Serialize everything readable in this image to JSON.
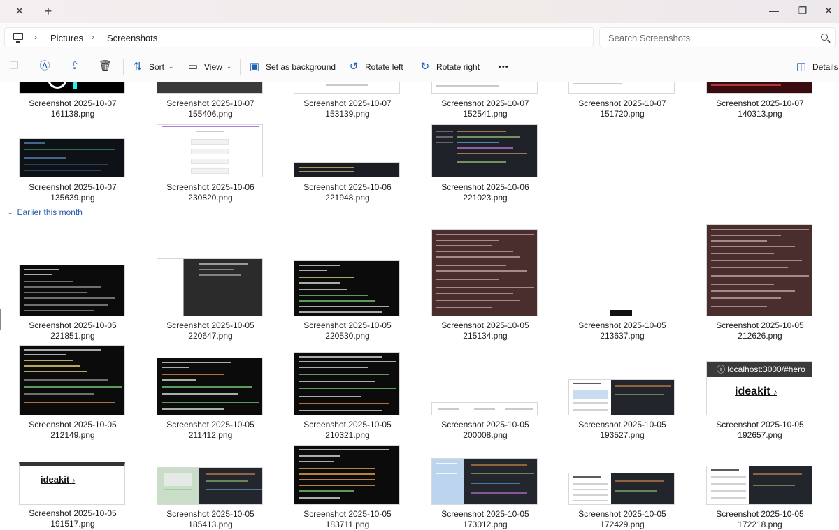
{
  "window": {
    "close_tab": "✕",
    "new_tab": "+",
    "minimize": "—",
    "maximize": "❐",
    "close": "✕"
  },
  "breadcrumb": [
    "Pictures",
    "Screenshots"
  ],
  "search": {
    "placeholder": "Search Screenshots"
  },
  "toolbar": {
    "sort": "Sort",
    "view": "View",
    "set_background": "Set as background",
    "rotate_left": "Rotate left",
    "rotate_right": "Rotate right",
    "more": "•••",
    "details": "Details"
  },
  "group": {
    "label": "Earlier this month"
  },
  "files": [
    {
      "line1": "Screenshot 2025-10-07",
      "line2": "161138.png"
    },
    {
      "line1": "Screenshot 2025-10-07",
      "line2": "155406.png"
    },
    {
      "line1": "Screenshot 2025-10-07",
      "line2": "153139.png"
    },
    {
      "line1": "Screenshot 2025-10-07",
      "line2": "152541.png"
    },
    {
      "line1": "Screenshot 2025-10-07",
      "line2": "151720.png"
    },
    {
      "line1": "Screenshot 2025-10-07",
      "line2": "140313.png"
    },
    {
      "line1": "Screenshot 2025-10-07",
      "line2": "135639.png"
    },
    {
      "line1": "Screenshot 2025-10-06",
      "line2": "230820.png"
    },
    {
      "line1": "Screenshot 2025-10-06",
      "line2": "221948.png"
    },
    {
      "line1": "Screenshot 2025-10-06",
      "line2": "221023.png"
    },
    {
      "line1": "Screenshot 2025-10-05",
      "line2": "221851.png"
    },
    {
      "line1": "Screenshot 2025-10-05",
      "line2": "220647.png"
    },
    {
      "line1": "Screenshot 2025-10-05",
      "line2": "220530.png"
    },
    {
      "line1": "Screenshot 2025-10-05",
      "line2": "215134.png"
    },
    {
      "line1": "Screenshot 2025-10-05",
      "line2": "213637.png"
    },
    {
      "line1": "Screenshot 2025-10-05",
      "line2": "212626.png"
    },
    {
      "line1": "Screenshot 2025-10-05",
      "line2": "212149.png"
    },
    {
      "line1": "Screenshot 2025-10-05",
      "line2": "211412.png"
    },
    {
      "line1": "Screenshot 2025-10-05",
      "line2": "210321.png"
    },
    {
      "line1": "Screenshot 2025-10-05",
      "line2": "200008.png"
    },
    {
      "line1": "Screenshot 2025-10-05",
      "line2": "193527.png"
    },
    {
      "line1": "Screenshot 2025-10-05",
      "line2": "192657.png"
    },
    {
      "line1": "Screenshot 2025-10-05",
      "line2": "191517.png"
    },
    {
      "line1": "Screenshot 2025-10-05",
      "line2": "185413.png"
    },
    {
      "line1": "Screenshot 2025-10-05",
      "line2": "183711.png"
    },
    {
      "line1": "Screenshot 2025-10-05",
      "line2": "173012.png"
    },
    {
      "line1": "Screenshot 2025-10-05",
      "line2": "172429.png"
    },
    {
      "line1": "Screenshot 2025-10-05",
      "line2": "172218.png"
    }
  ],
  "thumb_text": {
    "localhost_url": "localhost:3000/#hero",
    "ideakit": "ideakit",
    "tiktok_glyph": "♪"
  }
}
